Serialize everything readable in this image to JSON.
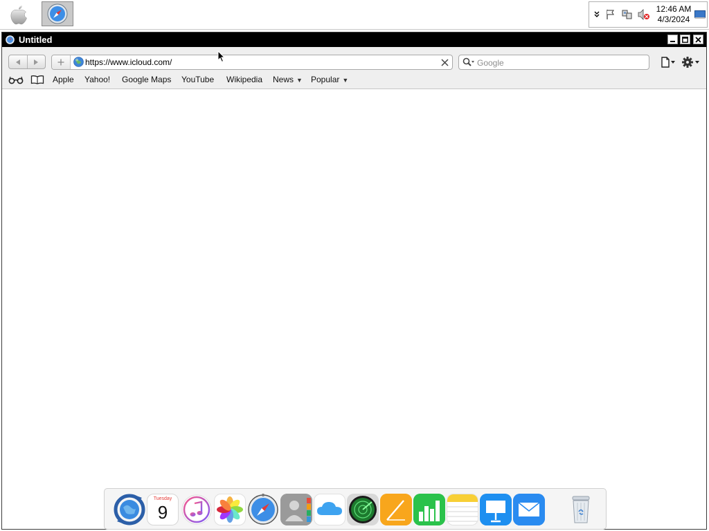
{
  "taskbar": {
    "apple_icon": "apple-logo-icon",
    "running_app_icon": "safari-compass-icon",
    "tray": {
      "icons": [
        "chevron-down-icon",
        "flag-icon",
        "network-icon",
        "volume-muted-icon",
        "desktop-icon"
      ],
      "time": "12:46 AM",
      "date": "4/3/2024"
    }
  },
  "window": {
    "title": "Untitled",
    "controls": [
      "minimize-icon",
      "maximize-icon",
      "close-icon"
    ]
  },
  "toolbar": {
    "url": "https://www.icloud.com/",
    "search_placeholder": "Google"
  },
  "bookmarks": {
    "icons": [
      "reading-list-glasses-icon",
      "bookmarks-book-icon"
    ],
    "items": [
      {
        "label": "Apple",
        "menu": false
      },
      {
        "label": "Yahoo!",
        "menu": false
      },
      {
        "label": "Google Maps",
        "menu": false
      },
      {
        "label": "YouTube",
        "menu": false
      },
      {
        "label": "Wikipedia",
        "menu": false
      },
      {
        "label": "News",
        "menu": true
      },
      {
        "label": "Popular",
        "menu": true
      }
    ]
  },
  "dock": {
    "calendar": {
      "weekday": "Tuesday",
      "day": "9"
    },
    "apps": [
      "sync-globe-icon",
      "calendar-icon",
      "music-icon",
      "photos-icon",
      "safari-icon",
      "contacts-icon",
      "icloud-icon",
      "radar-icon",
      "pages-icon",
      "numbers-icon",
      "notes-icon",
      "keynote-icon",
      "mail-icon",
      "trash-icon"
    ]
  },
  "colors": {
    "titlebar": "#000000",
    "toolbar": "#efefef",
    "link_blue": "#2a7ad8"
  }
}
